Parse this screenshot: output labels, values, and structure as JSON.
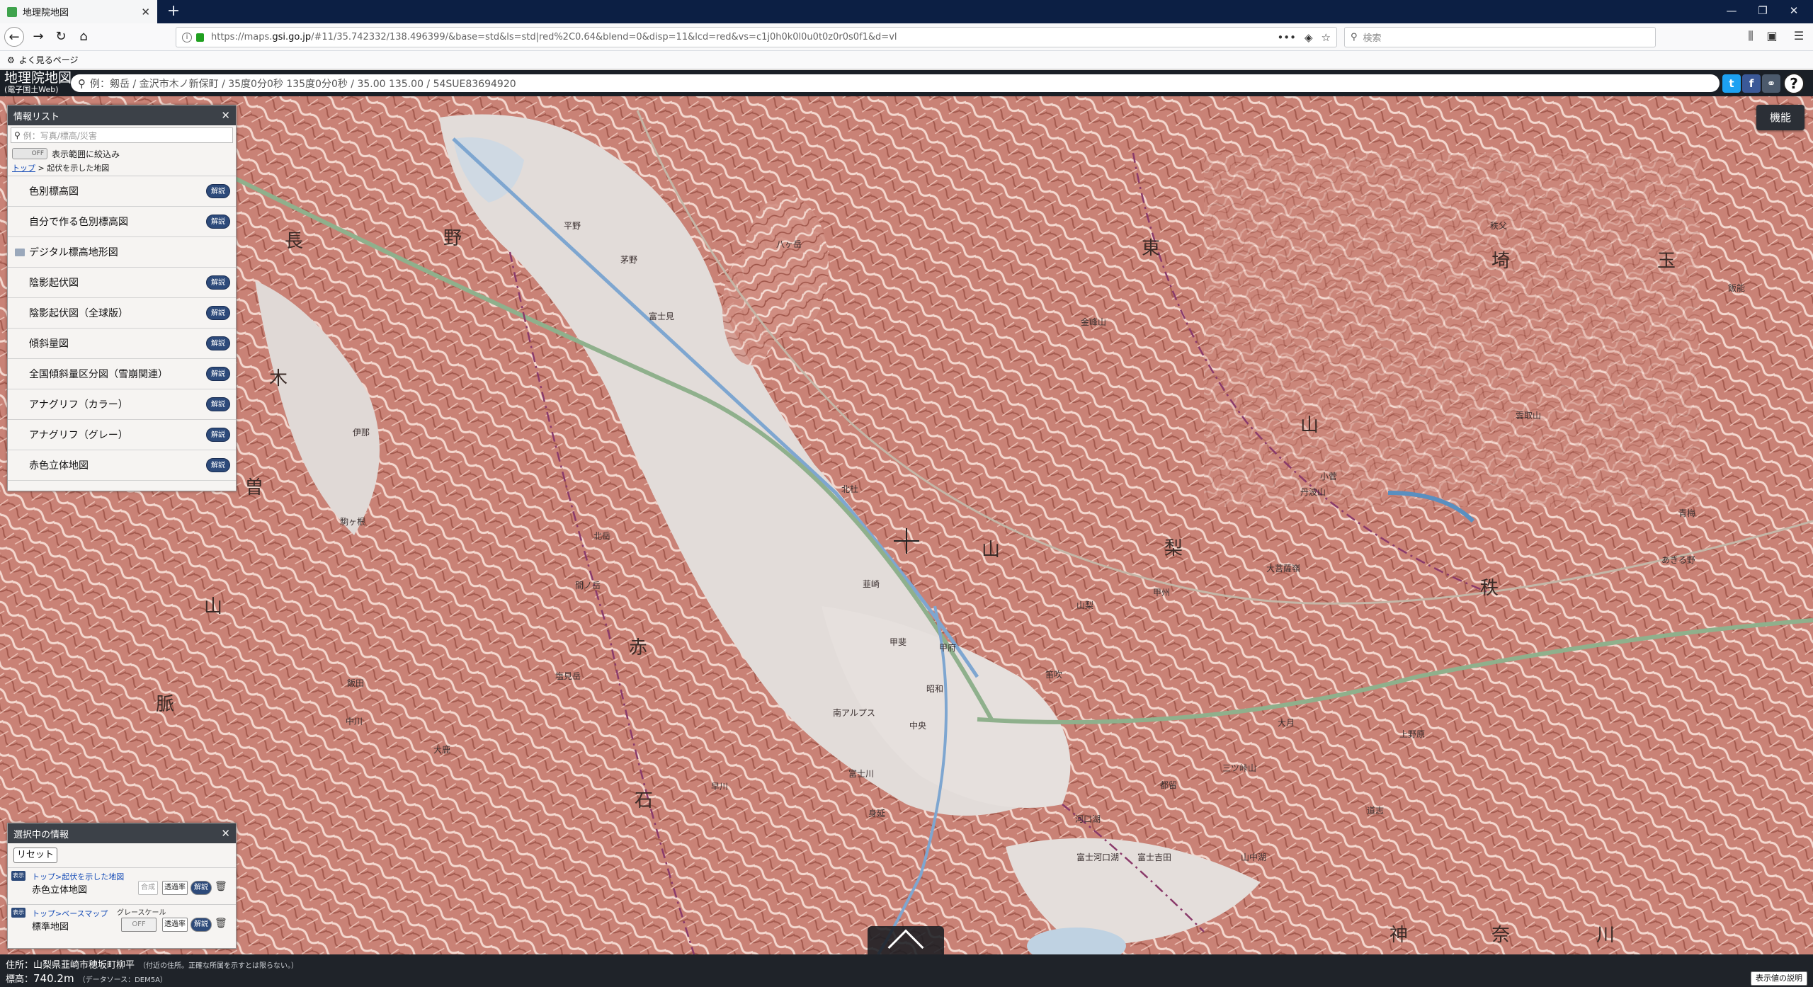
{
  "browser": {
    "tab_title": "地理院地図",
    "url_prefix": "https://maps.",
    "url_host": "gsi.go.jp",
    "url_rest": "/#11/35.742332/138.496399/&base=std&ls=std|red%2C0.64&blend=0&disp=11&lcd=red&vs=c1j0h0k0l0u0t0z0r0s0f1&d=vl",
    "search_placeholder": "検索",
    "bookmark": "よく見るページ"
  },
  "header": {
    "logo_main": "地理院地図",
    "logo_sub": "(電子国土Web)",
    "search_placeholder": "例：剱岳 / 金沢市木ノ新保町 / 35度0分0秒 135度0分0秒 / 35.00 135.00 / 54SUE83694920"
  },
  "info_panel": {
    "title": "情報リスト",
    "filter_placeholder": "例：写真/標高/災害",
    "toggle": "OFF",
    "narrow_label": "表示範囲に絞込み",
    "crumb_top": "トップ",
    "crumb_rest": " > 起伏を示した地図",
    "kaisetsu": "解説",
    "items": [
      {
        "label": "色別標高図"
      },
      {
        "label": "自分で作る色別標高図"
      },
      {
        "label": "デジタル標高地形図"
      },
      {
        "label": "陰影起伏図"
      },
      {
        "label": "陰影起伏図（全球版）"
      },
      {
        "label": "傾斜量図"
      },
      {
        "label": "全国傾斜量区分図（雪崩関連）"
      },
      {
        "label": "アナグリフ（カラー）"
      },
      {
        "label": "アナグリフ（グレー）"
      },
      {
        "label": "赤色立体地図"
      }
    ]
  },
  "selected_panel": {
    "title": "選択中の情報",
    "reset": "リセット",
    "hyoji": "表示",
    "item1_path": "トップ>起伏を示した地図",
    "item1_name": "赤色立体地図",
    "item1_ctl1": "合成",
    "item2_path": "トップ>ベースマップ",
    "item2_name": "標準地図",
    "item2_gray": "グレースケール",
    "item2_toggle": "OFF",
    "transparency": "透過率",
    "kaisetsu": "解説"
  },
  "map": {
    "kinou": "機能",
    "labels": {
      "naga": "長",
      "no": "野",
      "higashi": "東",
      "sai": "埼",
      "tama": "玉",
      "ki": "木",
      "so": "曽",
      "yama_l": "山",
      "myaku": "脈",
      "aka": "赤",
      "ishi": "石",
      "yama_c": "山",
      "nashi": "梨",
      "yama_r": "山",
      "chichi": "秩",
      "kami": "神",
      "na": "奈",
      "kawa": "川"
    },
    "places": {
      "p1": "平野",
      "p2": "茅野",
      "p3": "富士見",
      "p4": "北杜",
      "p5": "甲府",
      "p6": "韮崎",
      "p7": "甲斐",
      "p8": "昭和",
      "p9": "中央",
      "p10": "南アルプス",
      "p11": "笛吹",
      "p12": "山梨",
      "p13": "甲州",
      "p14": "大月",
      "p15": "都留",
      "p16": "富士吉田",
      "p17": "秩父",
      "p18": "飯能",
      "p19": "青梅",
      "p20": "あきる野",
      "p21": "伊那",
      "p22": "駒ヶ根",
      "p23": "飯田",
      "p24": "大鹿",
      "p25": "中川",
      "p26": "身延",
      "p27": "富士川",
      "p28": "早川",
      "p29": "小菅",
      "p30": "丹波山",
      "p31": "八ヶ岳",
      "p32": "金峰山",
      "p33": "北岳",
      "p34": "間ノ岳",
      "p35": "塩見岳",
      "p36": "雲取山",
      "p37": "大菩薩嶺",
      "p38": "三ツ峠山",
      "p39": "上野原",
      "p40": "道志",
      "p41": "河口湖",
      "p42": "山中湖",
      "p43": "富士河口湖"
    }
  },
  "footer": {
    "address_label": "住所：",
    "address": "山梨県韮崎市穂坂町柳平",
    "address_note": "（付近の住所。正確な所属を示すとは限らない。）",
    "elev_label": "標高：",
    "elevation": "740.2m",
    "elev_note": "（データソース：DEM5A）",
    "legend_btn": "表示値の説明"
  }
}
